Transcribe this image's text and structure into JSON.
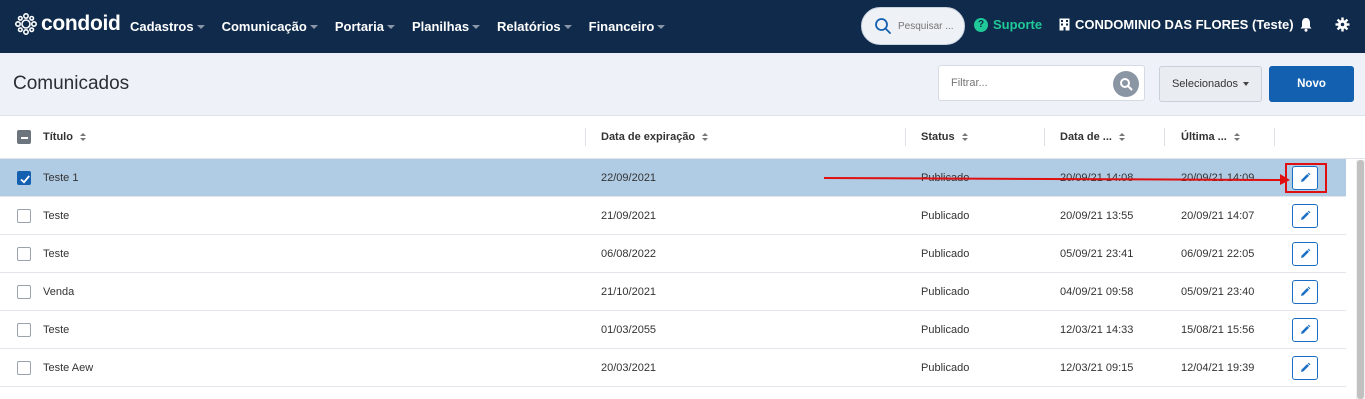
{
  "brand": {
    "name": "condoid"
  },
  "nav": {
    "menu": [
      {
        "label": "Cadastros"
      },
      {
        "label": "Comunicação"
      },
      {
        "label": "Portaria"
      },
      {
        "label": "Planilhas"
      },
      {
        "label": "Relatórios"
      },
      {
        "label": "Financeiro"
      }
    ],
    "search_placeholder": "Pesquisar ...",
    "support_label": "Suporte",
    "condo_label": "CONDOMINIO DAS FLORES (Teste)",
    "icons": {
      "search": "search-icon",
      "support": "question-circle-icon",
      "building": "building-icon",
      "bell": "bell-icon",
      "settings": "gear-icon"
    }
  },
  "page": {
    "title": "Comunicados",
    "filter_placeholder": "Filtrar...",
    "selected_button": "Selecionados",
    "new_button": "Novo"
  },
  "table": {
    "columns": [
      {
        "label": "Título"
      },
      {
        "label": "Data de expiração"
      },
      {
        "label": "Status"
      },
      {
        "label": "Data de ..."
      },
      {
        "label": "Última ..."
      }
    ],
    "rows": [
      {
        "title": "Teste 1",
        "expiration": "22/09/2021",
        "status": "Publicado",
        "created": "20/09/21 14:08",
        "updated": "20/09/21 14:09",
        "selected": true
      },
      {
        "title": "Teste",
        "expiration": "21/09/2021",
        "status": "Publicado",
        "created": "20/09/21 13:55",
        "updated": "20/09/21 14:07",
        "selected": false
      },
      {
        "title": "Teste",
        "expiration": "06/08/2022",
        "status": "Publicado",
        "created": "05/09/21 23:41",
        "updated": "06/09/21 22:05",
        "selected": false
      },
      {
        "title": "Venda",
        "expiration": "21/10/2021",
        "status": "Publicado",
        "created": "04/09/21 09:58",
        "updated": "05/09/21 23:40",
        "selected": false
      },
      {
        "title": "Teste",
        "expiration": "01/03/2055",
        "status": "Publicado",
        "created": "12/03/21 14:33",
        "updated": "15/08/21 15:56",
        "selected": false
      },
      {
        "title": "Teste Aew",
        "expiration": "20/03/2021",
        "status": "Publicado",
        "created": "12/03/21 09:15",
        "updated": "12/04/21 19:39",
        "selected": false
      }
    ]
  },
  "colors": {
    "nav_bg": "#0f2a4a",
    "accent": "#1460b0",
    "support": "#20c997",
    "selected_row": "#b0cbe4",
    "highlight": "#e01010"
  }
}
